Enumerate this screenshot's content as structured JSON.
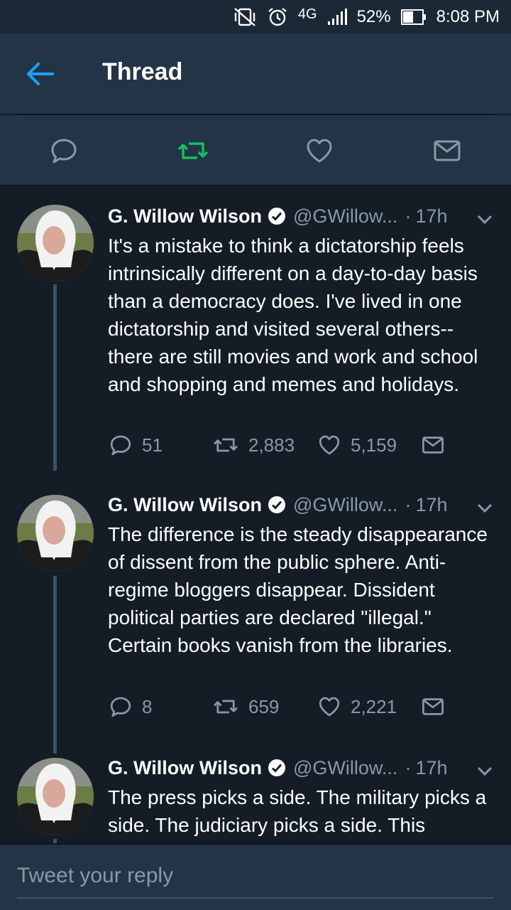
{
  "status_bar": {
    "network": "4G",
    "battery": "52%",
    "time": "8:08 PM",
    "icons": [
      "vibrate-off-icon",
      "alarm-icon",
      "signal-icon",
      "battery-icon"
    ]
  },
  "header": {
    "title": "Thread",
    "back_icon": "arrow-left-icon"
  },
  "actions": {
    "icons": [
      "reply-icon",
      "retweet-icon",
      "like-icon",
      "dm-icon"
    ],
    "retweet_active_color": "#17bf63"
  },
  "tweets": [
    {
      "name": "G. Willow Wilson",
      "handle": "@GWillow...",
      "dot": "·",
      "time": "17h",
      "text": "It's a mistake to think a dictatorship feels intrinsically different on a day-to-day basis than a democracy does. I've lived in one dictatorship and visited several others--there are still movies and work and school and shopping and memes and holidays.",
      "replies": "51",
      "retweets": "2,883",
      "likes": "5,159"
    },
    {
      "name": "G. Willow Wilson",
      "handle": "@GWillow...",
      "dot": "·",
      "time": "17h",
      "text": "The difference is the steady disappearance of dissent from the public sphere. Anti-regime bloggers disappear. Dissident political parties are declared \"illegal.\" Certain books vanish from the libraries.",
      "replies": "8",
      "retweets": "659",
      "likes": "2,221"
    },
    {
      "name": "G. Willow Wilson",
      "handle": "@GWillow...",
      "dot": "·",
      "time": "17h",
      "text": "The press picks a side. The military picks a side. The judiciary picks a side. This"
    }
  ],
  "reply": {
    "placeholder": "Tweet your reply"
  },
  "colors": {
    "background": "#141d26",
    "bar": "#243447",
    "accent": "#1da1f2",
    "muted": "#8899a6",
    "retweet_green": "#17bf63"
  }
}
